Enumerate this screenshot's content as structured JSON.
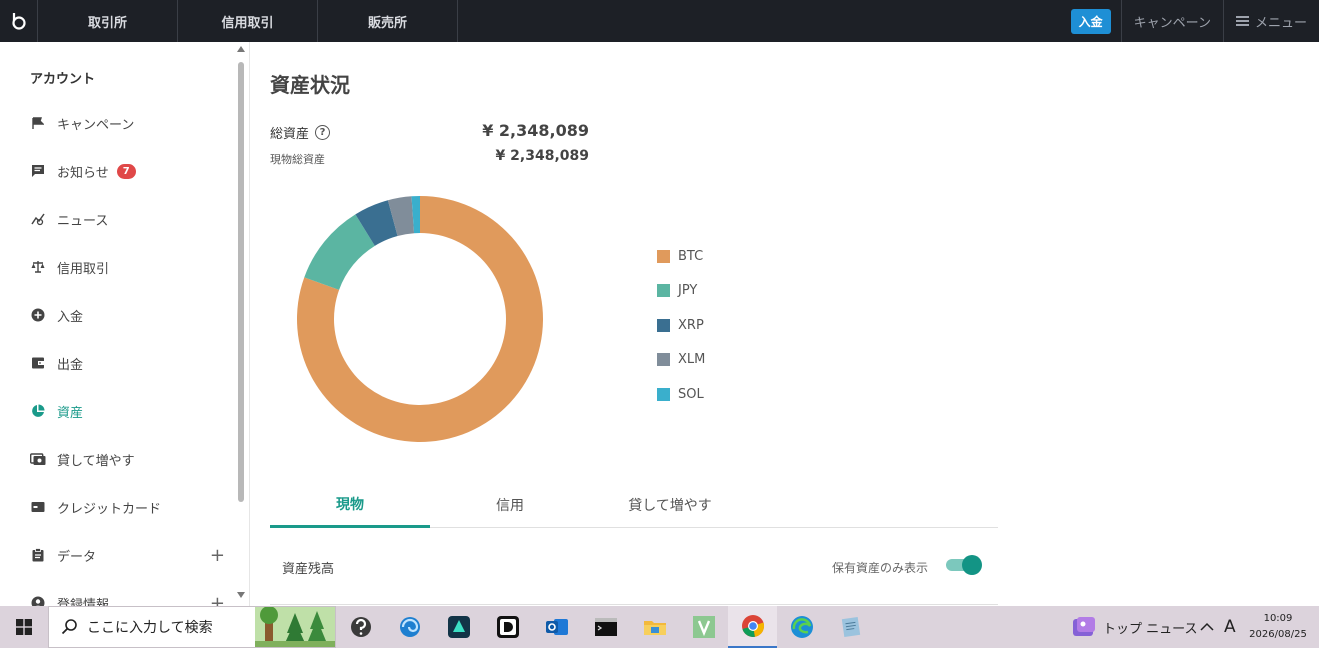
{
  "topnav": {
    "tabs": [
      "取引所",
      "信用取引",
      "販売所"
    ],
    "deposit_label": "入金",
    "campaign_label": "キャンペーン",
    "menu_label": "メニュー"
  },
  "sidebar": {
    "header": "アカウント",
    "items": [
      {
        "label": "キャンペーン",
        "icon": "flag-icon"
      },
      {
        "label": "お知らせ",
        "icon": "message-icon",
        "badge": "7"
      },
      {
        "label": "ニュース",
        "icon": "chart-news-icon"
      },
      {
        "label": "信用取引",
        "icon": "scale-icon"
      },
      {
        "label": "入金",
        "icon": "plus-circle-icon"
      },
      {
        "label": "出金",
        "icon": "wallet-icon"
      },
      {
        "label": "資産",
        "icon": "pie-chart-icon",
        "active": true
      },
      {
        "label": "貸して増やす",
        "icon": "lend-icon"
      },
      {
        "label": "クレジットカード",
        "icon": "credit-card-icon"
      },
      {
        "label": "データ",
        "icon": "clipboard-icon",
        "expandable": true
      },
      {
        "label": "登録情報",
        "icon": "user-circle-icon",
        "expandable": true
      }
    ]
  },
  "main": {
    "title": "資産状況",
    "total_assets_label": "総資産",
    "total_assets_value": "¥ 2,348,089",
    "spot_assets_label": "現物総資産",
    "spot_assets_value": "¥ 2,348,089",
    "tabs": [
      "現物",
      "信用",
      "貸して増やす"
    ],
    "balance_label": "資産残高",
    "holdings_only_label": "保有資産のみ表示",
    "holdings_only_enabled": true
  },
  "chart_data": {
    "type": "pie",
    "categories": [
      "BTC",
      "JPY",
      "XRP",
      "XLM",
      "SOL"
    ],
    "values": [
      80.5,
      10.7,
      4.6,
      3.1,
      1.1
    ],
    "colors": [
      "#e09a5c",
      "#5bb5a2",
      "#3a6f91",
      "#808d9a",
      "#3aafcc"
    ],
    "donut": true,
    "legend": "right"
  },
  "taskbar": {
    "search_placeholder": "ここに入力して検索",
    "news_label": "トップ ニュース",
    "ime_label": "A",
    "time": "10:09",
    "date": "2026/08/25"
  }
}
